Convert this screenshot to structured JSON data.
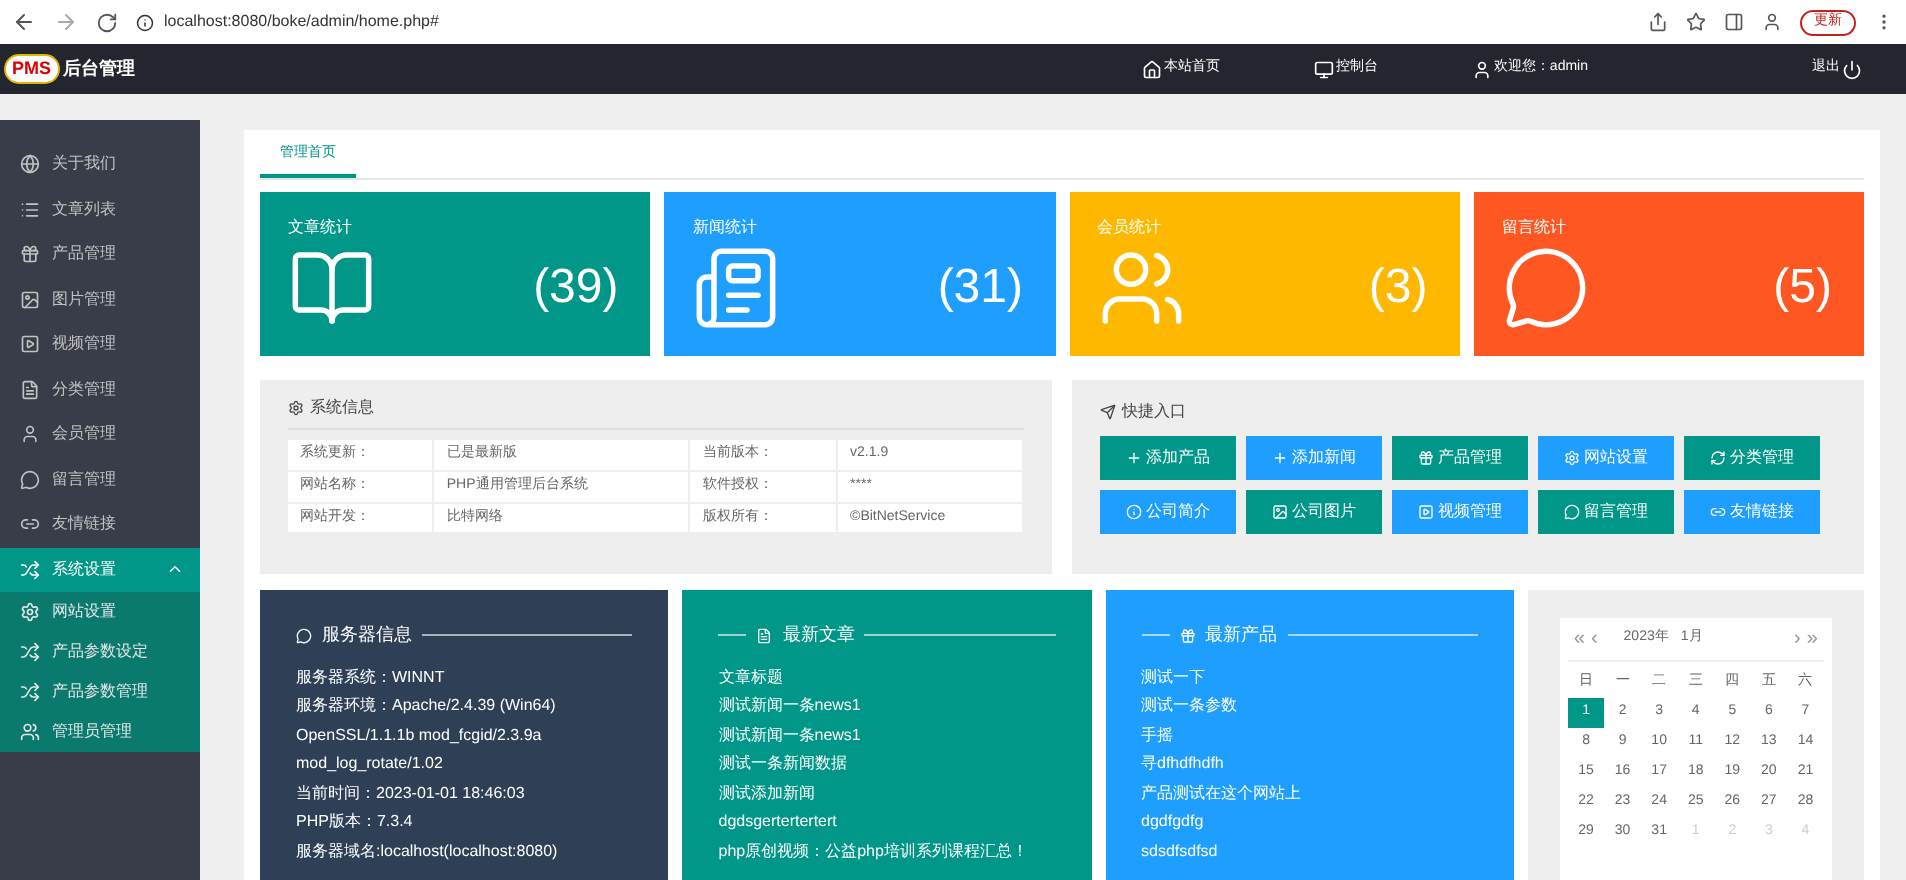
{
  "browser": {
    "url": "localhost:8080/boke/admin/home.php#",
    "update_button": "更新"
  },
  "header": {
    "logo_badge": "PMS",
    "logo_text": "后台管理",
    "nav": [
      {
        "kind": "home",
        "label": "本站首页"
      },
      {
        "kind": "console",
        "label": "控制台"
      },
      {
        "kind": "user",
        "label": "欢迎您：admin"
      },
      {
        "kind": "logout",
        "label": "退出"
      }
    ]
  },
  "sidebar": {
    "items": [
      {
        "kind": "globe",
        "label": "关于我们",
        "selected": false
      },
      {
        "kind": "list",
        "label": "文章列表",
        "selected": false
      },
      {
        "kind": "gift",
        "label": "产品管理",
        "selected": false
      },
      {
        "kind": "image",
        "label": "图片管理",
        "selected": false
      },
      {
        "kind": "video",
        "label": "视频管理",
        "selected": false
      },
      {
        "kind": "file",
        "label": "分类管理",
        "selected": false
      },
      {
        "kind": "user",
        "label": "会员管理",
        "selected": false
      },
      {
        "kind": "chat",
        "label": "留言管理",
        "selected": false
      },
      {
        "kind": "link",
        "label": "友情链接",
        "selected": false
      },
      {
        "kind": "shuffle",
        "label": "系统设置",
        "selected": true,
        "expanded": true,
        "children": [
          {
            "kind": "gear",
            "label": "网站设置"
          },
          {
            "kind": "shuffle",
            "label": "产品参数设定"
          },
          {
            "kind": "shuffle",
            "label": "产品参数管理"
          },
          {
            "kind": "users",
            "label": "管理员管理"
          }
        ]
      }
    ]
  },
  "tabs": [
    {
      "label": "管理首页",
      "selected": true
    }
  ],
  "stats": [
    {
      "kind": "book",
      "title": "文章统计",
      "count": "(39)",
      "color": "#009688"
    },
    {
      "kind": "paper",
      "title": "新闻统计",
      "count": "(31)",
      "color": "#1e9fff"
    },
    {
      "kind": "users",
      "title": "会员统计",
      "count": "(3)",
      "color": "#ffb800"
    },
    {
      "kind": "chat",
      "title": "留言统计",
      "count": "(5)",
      "color": "#ff5722"
    }
  ],
  "system_info": {
    "title": "系统信息",
    "rows": [
      [
        "系统更新：",
        "已是最新版",
        "当前版本：",
        "v2.1.9"
      ],
      [
        "网站名称：",
        "PHP通用管理后台系统",
        "软件授权：",
        "****"
      ],
      [
        "网站开发：",
        "比特网络",
        "版权所有：",
        "©BitNetService"
      ]
    ]
  },
  "quick_entry": {
    "title": "快捷入口",
    "buttons": [
      {
        "kind": "plus",
        "label": "添加产品",
        "color": "#009688"
      },
      {
        "kind": "plus",
        "label": "添加新闻",
        "color": "#1e9fff"
      },
      {
        "kind": "gift",
        "label": "产品管理",
        "color": "#009688"
      },
      {
        "kind": "gear",
        "label": "网站设置",
        "color": "#1e9fff"
      },
      {
        "kind": "refresh",
        "label": "分类管理",
        "color": "#009688"
      },
      {
        "kind": "info",
        "label": "公司简介",
        "color": "#1e9fff"
      },
      {
        "kind": "image",
        "label": "公司图片",
        "color": "#009688"
      },
      {
        "kind": "video",
        "label": "视频管理",
        "color": "#1e9fff"
      },
      {
        "kind": "chat",
        "label": "留言管理",
        "color": "#009688"
      },
      {
        "kind": "link",
        "label": "友情链接",
        "color": "#1e9fff"
      }
    ]
  },
  "panels": [
    {
      "kind": "server",
      "title": "服务器信息",
      "color": "#2f4056",
      "lines": [
        "服务器系统：WINNT",
        "服务器环境：Apache/2.4.39 (Win64)",
        "OpenSSL/1.1.1b mod_fcgid/2.3.9a",
        "mod_log_rotate/1.02",
        "当前时间：2023-01-01 18:46:03",
        "PHP版本：7.3.4",
        "服务器域名:localhost(localhost:8080)"
      ]
    },
    {
      "kind": "articles",
      "title": "最新文章",
      "color": "#009688",
      "lines": [
        "文章标题",
        "测试新闻一条news1",
        "测试新闻一条news1",
        "测试一条新闻数据",
        "测试添加新闻",
        "dgdsgertertertert",
        "php原创视频：公益php培训系列课程汇总！"
      ]
    },
    {
      "kind": "products",
      "title": "最新产品",
      "color": "#1e9fff",
      "lines": [
        "测试一下",
        "测试一条参数",
        "手摇",
        "寻dfhdfhdfh",
        "产品测试在这个网站上",
        "dgdfgdfg",
        "sdsdfsdfsd"
      ]
    }
  ],
  "calendar": {
    "year": "2023年",
    "month": "1月",
    "prev_year": "«",
    "prev": "‹",
    "next": "›",
    "next_year": "»",
    "weekdays": [
      "日",
      "一",
      "二",
      "三",
      "四",
      "五",
      "六"
    ],
    "days": [
      {
        "label": "1",
        "selected": true,
        "muted": false
      },
      {
        "label": "2",
        "selected": false,
        "muted": false
      },
      {
        "label": "3",
        "selected": false,
        "muted": false
      },
      {
        "label": "4",
        "selected": false,
        "muted": false
      },
      {
        "label": "5",
        "selected": false,
        "muted": false
      },
      {
        "label": "6",
        "selected": false,
        "muted": false
      },
      {
        "label": "7",
        "selected": false,
        "muted": false
      },
      {
        "label": "8",
        "selected": false,
        "muted": false
      },
      {
        "label": "9",
        "selected": false,
        "muted": false
      },
      {
        "label": "10",
        "selected": false,
        "muted": false
      },
      {
        "label": "11",
        "selected": false,
        "muted": false
      },
      {
        "label": "12",
        "selected": false,
        "muted": false
      },
      {
        "label": "13",
        "selected": false,
        "muted": false
      },
      {
        "label": "14",
        "selected": false,
        "muted": false
      },
      {
        "label": "15",
        "selected": false,
        "muted": false
      },
      {
        "label": "16",
        "selected": false,
        "muted": false
      },
      {
        "label": "17",
        "selected": false,
        "muted": false
      },
      {
        "label": "18",
        "selected": false,
        "muted": false
      },
      {
        "label": "19",
        "selected": false,
        "muted": false
      },
      {
        "label": "20",
        "selected": false,
        "muted": false
      },
      {
        "label": "21",
        "selected": false,
        "muted": false
      },
      {
        "label": "22",
        "selected": false,
        "muted": false
      },
      {
        "label": "23",
        "selected": false,
        "muted": false
      },
      {
        "label": "24",
        "selected": false,
        "muted": false
      },
      {
        "label": "25",
        "selected": false,
        "muted": false
      },
      {
        "label": "26",
        "selected": false,
        "muted": false
      },
      {
        "label": "27",
        "selected": false,
        "muted": false
      },
      {
        "label": "28",
        "selected": false,
        "muted": false
      },
      {
        "label": "29",
        "selected": false,
        "muted": false
      },
      {
        "label": "30",
        "selected": false,
        "muted": false
      },
      {
        "label": "31",
        "selected": false,
        "muted": false
      },
      {
        "label": "1",
        "selected": false,
        "muted": true
      },
      {
        "label": "2",
        "selected": false,
        "muted": true
      },
      {
        "label": "3",
        "selected": false,
        "muted": true
      },
      {
        "label": "4",
        "selected": false,
        "muted": true
      }
    ]
  }
}
